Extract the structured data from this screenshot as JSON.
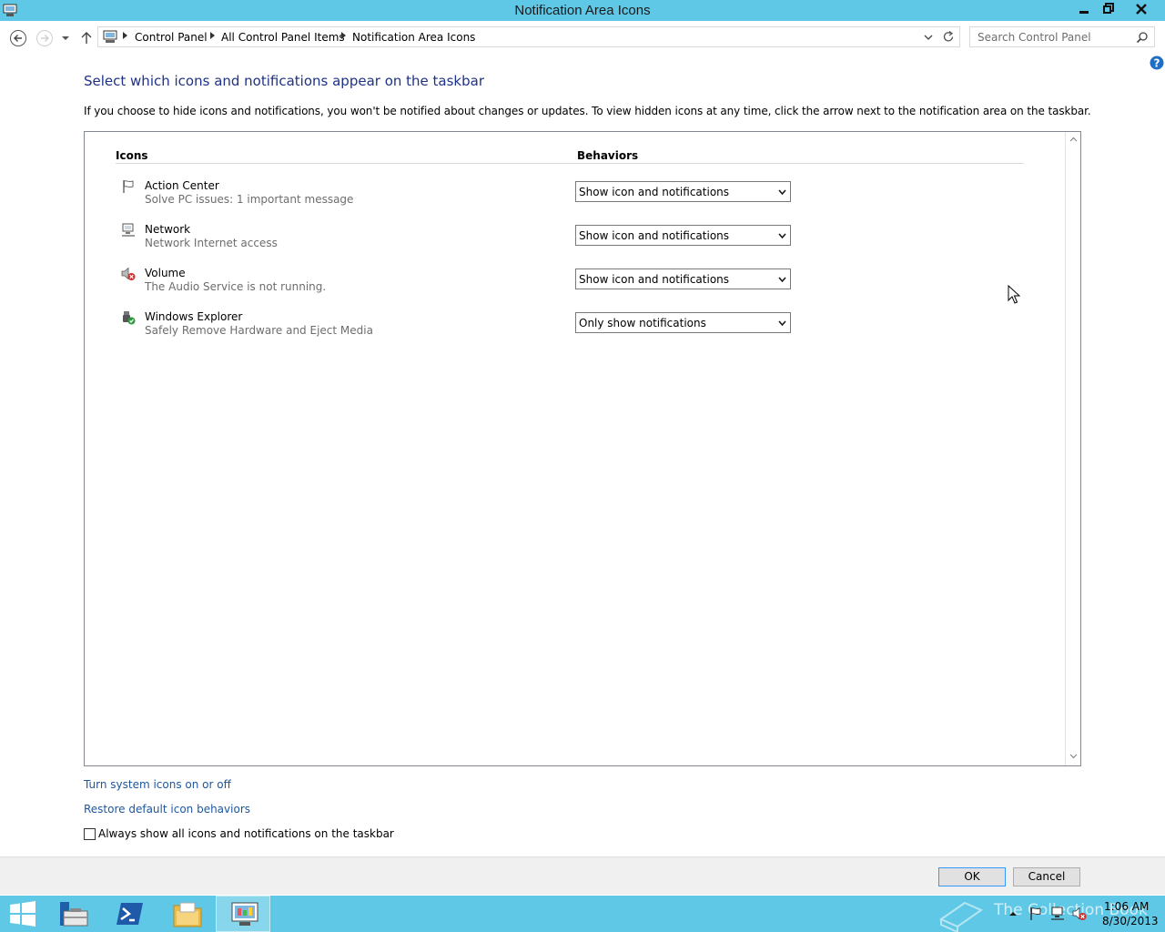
{
  "window": {
    "title": "Notification Area Icons"
  },
  "breadcrumb": {
    "items": [
      "Control Panel",
      "All Control Panel Items",
      "Notification Area Icons"
    ]
  },
  "search": {
    "placeholder": "Search Control Panel"
  },
  "main": {
    "heading": "Select which icons and notifications appear on the taskbar",
    "intro": "If you choose to hide icons and notifications, you won't be notified about changes or updates. To view hidden icons at any time, click the arrow next to the notification area on the taskbar.",
    "columns": {
      "icons": "Icons",
      "behaviors": "Behaviors"
    },
    "rows": [
      {
        "name": "Action Center",
        "description": "Solve PC issues: 1 important message",
        "behavior": "Show icon and notifications",
        "icon": "flag-icon"
      },
      {
        "name": "Network",
        "description": "Network Internet access",
        "behavior": "Show icon and notifications",
        "icon": "network-icon"
      },
      {
        "name": "Volume",
        "description": "The Audio Service is not running.",
        "behavior": "Show icon and notifications",
        "icon": "volume-muted-icon"
      },
      {
        "name": "Windows Explorer",
        "description": "Safely Remove Hardware and Eject Media",
        "behavior": "Only show notifications",
        "icon": "usb-safe-remove-icon"
      }
    ]
  },
  "links": {
    "system_icons": "Turn system icons on or off",
    "restore": "Restore default icon behaviors"
  },
  "always_show": {
    "label": "Always show all icons and notifications on the taskbar",
    "checked": false
  },
  "buttons": {
    "ok": "OK",
    "cancel": "Cancel"
  },
  "taskbar": {
    "watermark": "The Collection Book",
    "time": "1:06 AM",
    "date": "8/30/2013"
  },
  "colors": {
    "titlebar": "#5fc8e6",
    "heading": "#1e3287",
    "link": "#1e57a0"
  }
}
